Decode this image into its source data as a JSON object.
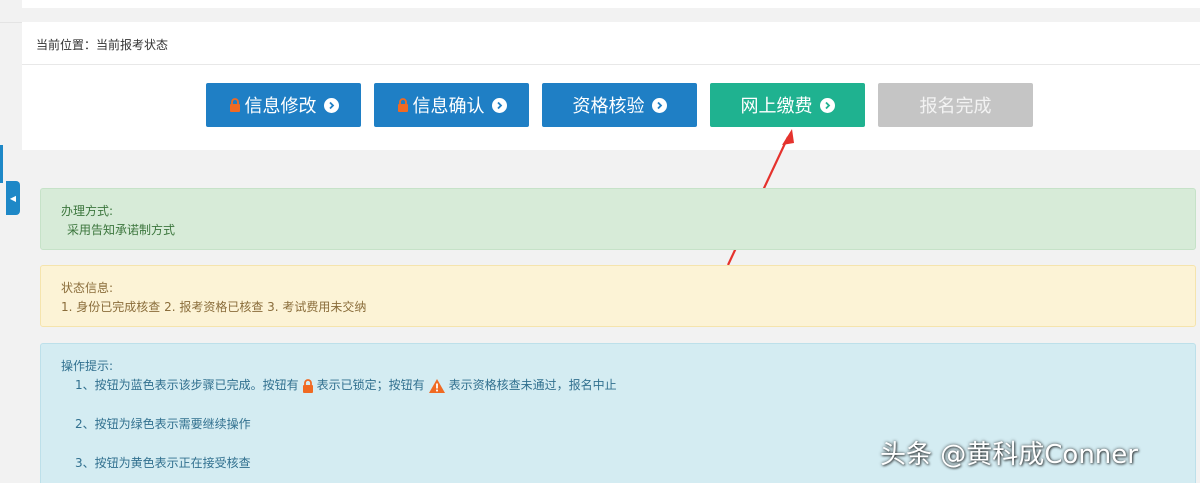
{
  "breadcrumb": "当前位置：当前报考状态",
  "steps": [
    {
      "label": "信息修改",
      "state": "locked",
      "color": "#1f7fc5"
    },
    {
      "label": "信息确认",
      "state": "locked",
      "color": "#1f7fc5"
    },
    {
      "label": "资格核验",
      "state": "done",
      "color": "#1f7fc5"
    },
    {
      "label": "网上缴费",
      "state": "current",
      "color": "#1fb290"
    },
    {
      "label": "报名完成",
      "state": "disabled",
      "color": "#c5c5c5"
    }
  ],
  "method": {
    "title": "办理方式:",
    "body": "采用告知承诺制方式"
  },
  "status": {
    "title": "状态信息:",
    "body": "1. 身份已完成核查 2. 报考资格已核查 3. 考试费用未交纳"
  },
  "tips": {
    "title": "操作提示:",
    "line1_prefix": "1、按钮为蓝色表示该步骤已完成。按钮有",
    "line1_mid": "表示已锁定；按钮有",
    "line1_suffix": "表示资格核查未通过，报名中止",
    "line2": "2、按钮为绿色表示需要继续操作",
    "line3": "3、按钮为黄色表示正在接受核查"
  },
  "watermark": "头条 @黄科成Conner",
  "icons": {
    "lock": "lock-icon",
    "arrow": "circle-arrow-right-icon",
    "warning": "warning-icon",
    "collapse": "caret-left-icon"
  },
  "colors": {
    "blue": "#1f7fc5",
    "green": "#1fb290",
    "gray": "#c5c5c5",
    "lock_orange": "#f06a23",
    "annotation_red": "#e5322d"
  }
}
